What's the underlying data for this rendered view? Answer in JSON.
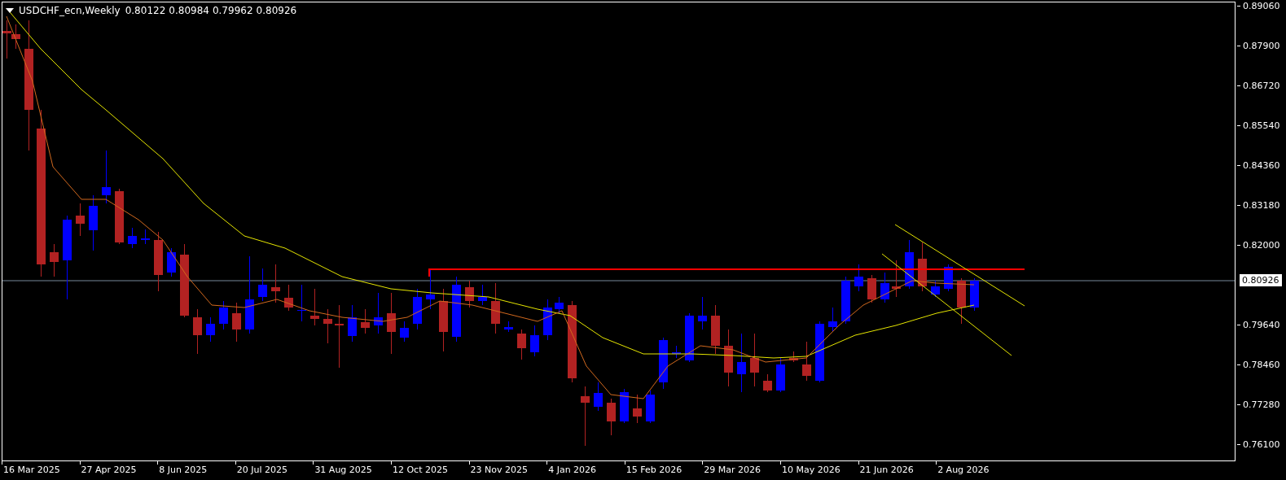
{
  "header": {
    "symbol": "USDCHF_ecn,Weekly",
    "ohlc": [
      "0.80122",
      "0.80984",
      "0.79962",
      "0.80926"
    ]
  },
  "price_axis": {
    "ticks": [
      "0.89060",
      "0.87900",
      "0.86720",
      "0.85540",
      "0.84360",
      "0.83180",
      "0.82000",
      "0.79640",
      "0.78460",
      "0.77280",
      "0.76100"
    ]
  },
  "current_price": "0.80926",
  "time_axis": {
    "labels": [
      "16 Mar 2025",
      "27 Apr 2025",
      "8 Jun 2025",
      "20 Jul 2025",
      "31 Aug 2025",
      "12 Oct 2025",
      "23 Nov 2025",
      "4 Jan 2026",
      "15 Feb 2026",
      "29 Mar 2026",
      "10 May 2026",
      "21 Jun 2026",
      "2 Aug 2026"
    ]
  }
}
